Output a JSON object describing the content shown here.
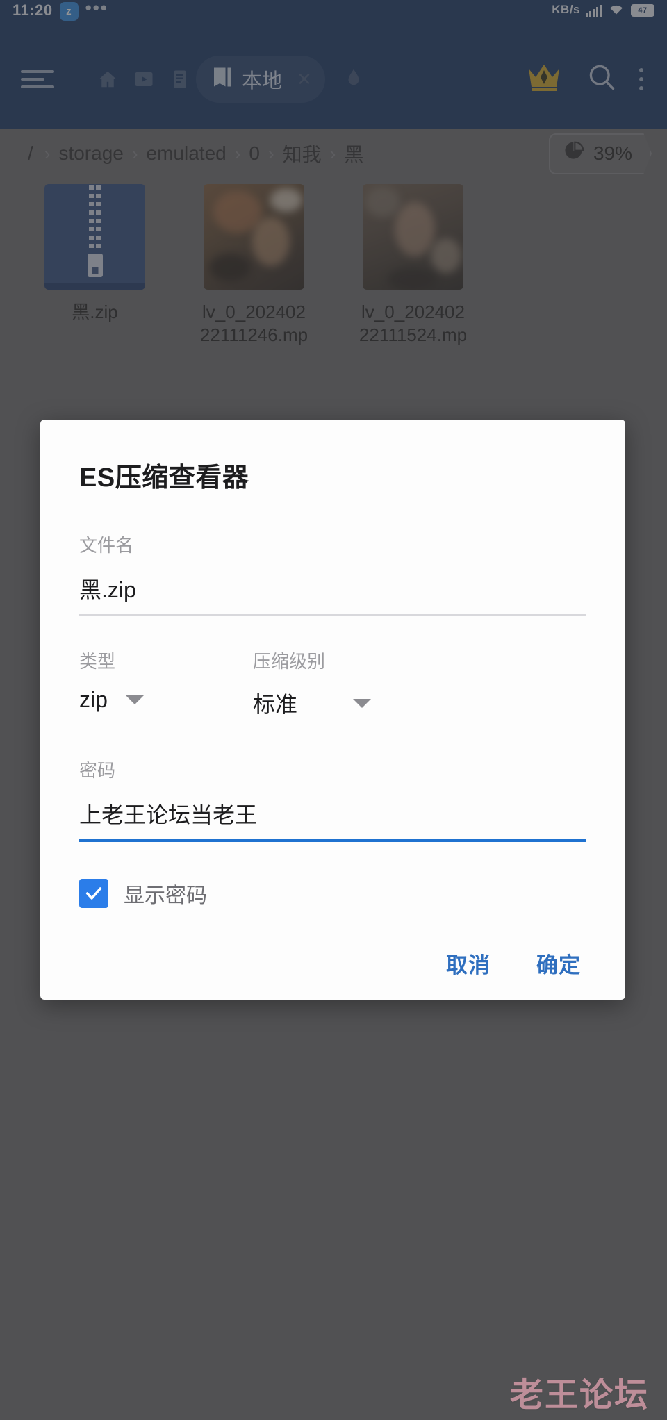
{
  "statusbar": {
    "time": "11:20",
    "app_badge": "z",
    "dots": "•••",
    "net_speed": "KB/s",
    "battery": "47"
  },
  "toolbar": {
    "menu_icon": "hamburger-icon",
    "home_icon": "home-icon",
    "video_icon": "video-icon",
    "document_icon": "document-icon",
    "tab_icon": "book-icon",
    "tab_label": "本地",
    "tab_close": "×",
    "cloud_icon": "cloud-icon",
    "crown_icon": "crown-icon",
    "search_icon": "search-icon",
    "overflow_icon": "kebab-menu-icon"
  },
  "breadcrumb": {
    "separator": "›",
    "items": [
      "/",
      "storage",
      "emulated",
      "0",
      "知我",
      "黑"
    ]
  },
  "storage": {
    "icon": "pie-chart-icon",
    "percent": "39%"
  },
  "files": [
    {
      "name": "黑.zip",
      "type": "zip"
    },
    {
      "name": "lv_0_20240222111246.mp",
      "type": "video"
    },
    {
      "name": "lv_0_20240222111524.mp",
      "type": "video"
    }
  ],
  "dialog": {
    "title": "ES压缩查看器",
    "filename_label": "文件名",
    "filename_value": "黑.zip",
    "type_label": "类型",
    "type_value": "zip",
    "level_label": "压缩级别",
    "level_value": "标准",
    "password_label": "密码",
    "password_value": "上老王论坛当老王",
    "show_password_label": "显示密码",
    "show_password_checked": true,
    "cancel_label": "取消",
    "confirm_label": "确定"
  },
  "watermark": {
    "text": "老王论坛"
  },
  "colors": {
    "header_blue": "#153363",
    "accent_blue": "#1f72d0",
    "checkbox_blue": "#2b7de9",
    "button_blue": "#2f6fbf",
    "crown_gold": "#c9a227",
    "watermark_pink": "#e8a6b4",
    "zip_icon_blue": "#2e4a7d"
  }
}
